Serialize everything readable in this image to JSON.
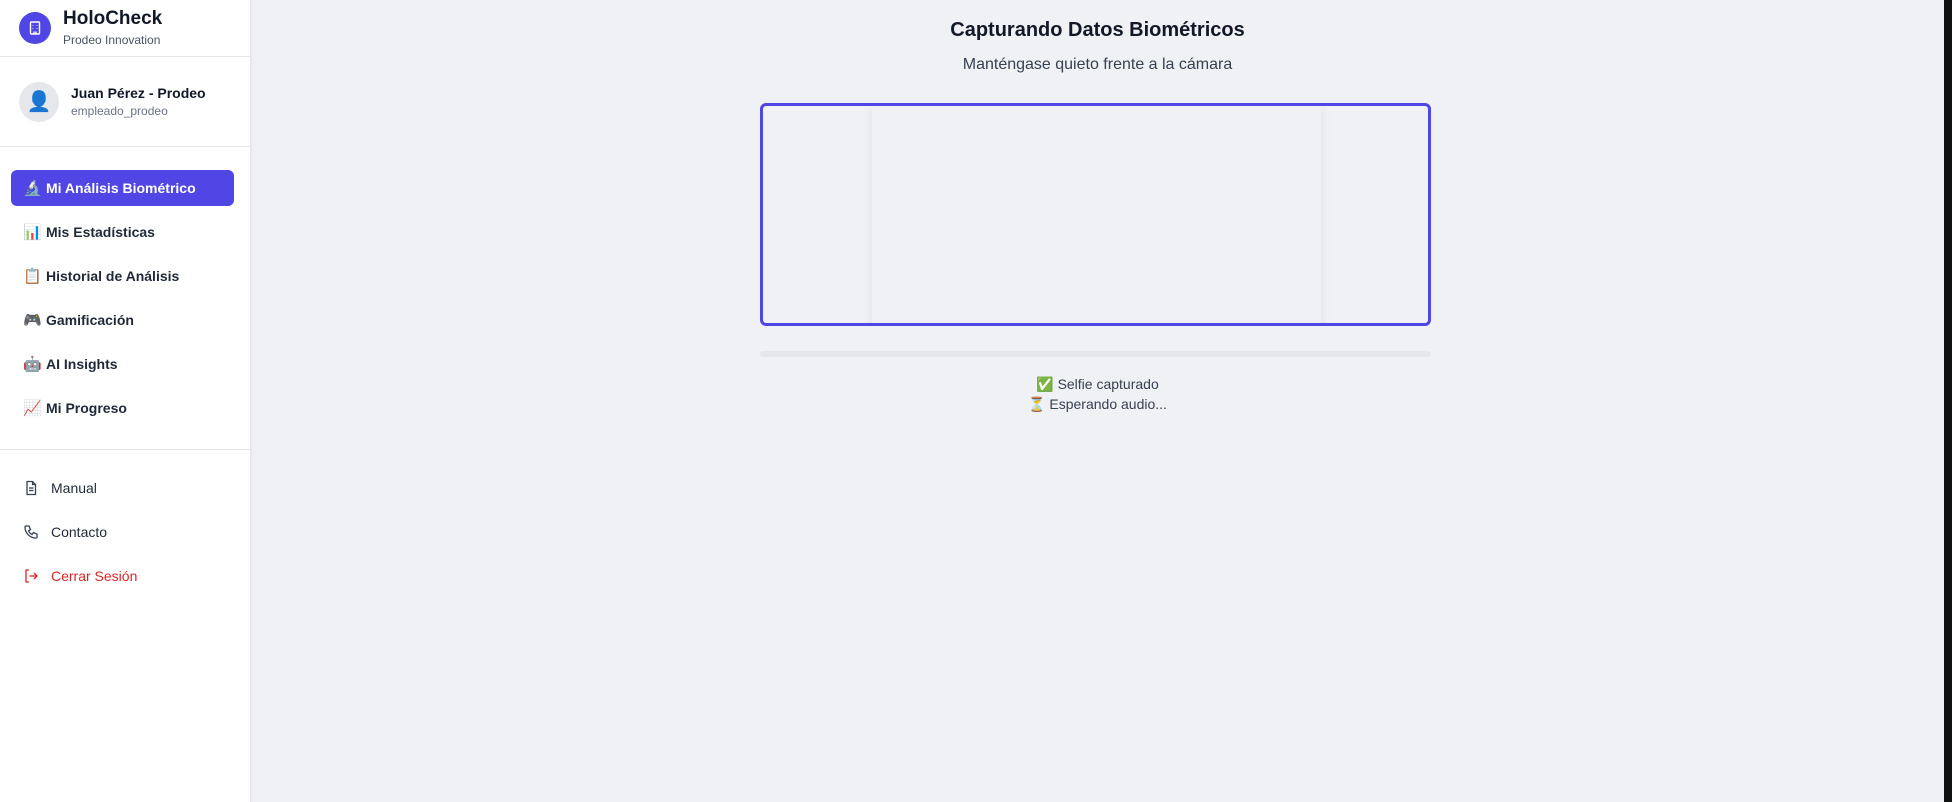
{
  "brand": {
    "title": "HoloCheck",
    "subtitle": "Prodeo Innovation",
    "logo_icon": "building-icon"
  },
  "user": {
    "name": "Juan Pérez - Prodeo",
    "handle": "empleado_prodeo",
    "avatar_icon": "👤"
  },
  "nav": [
    {
      "emoji": "🔬",
      "label": "Mi Análisis Biométrico",
      "active": true
    },
    {
      "emoji": "📊",
      "label": "Mis Estadísticas"
    },
    {
      "emoji": "📋",
      "label": "Historial de Análisis"
    },
    {
      "emoji": "🎮",
      "label": "Gamificación"
    },
    {
      "emoji": "🤖",
      "label": "AI Insights"
    },
    {
      "emoji": "📈",
      "label": "Mi Progreso"
    }
  ],
  "links": [
    {
      "label": "Manual",
      "icon": "document-icon"
    },
    {
      "label": "Contacto",
      "icon": "phone-icon"
    },
    {
      "label": "Cerrar Sesión",
      "icon": "logout-icon"
    }
  ],
  "main": {
    "title": "Capturando Datos Biométricos",
    "subtitle": "Manténgase quieto frente a la cámara",
    "progress_fraction": 0,
    "status": [
      {
        "emoji": "✅",
        "text": "Selfie capturado"
      },
      {
        "emoji": "⏳",
        "text": "Esperando audio..."
      }
    ]
  },
  "colors": {
    "accent": "#4f46e5",
    "danger": "#dc2626",
    "background": "#f0f1f5"
  }
}
